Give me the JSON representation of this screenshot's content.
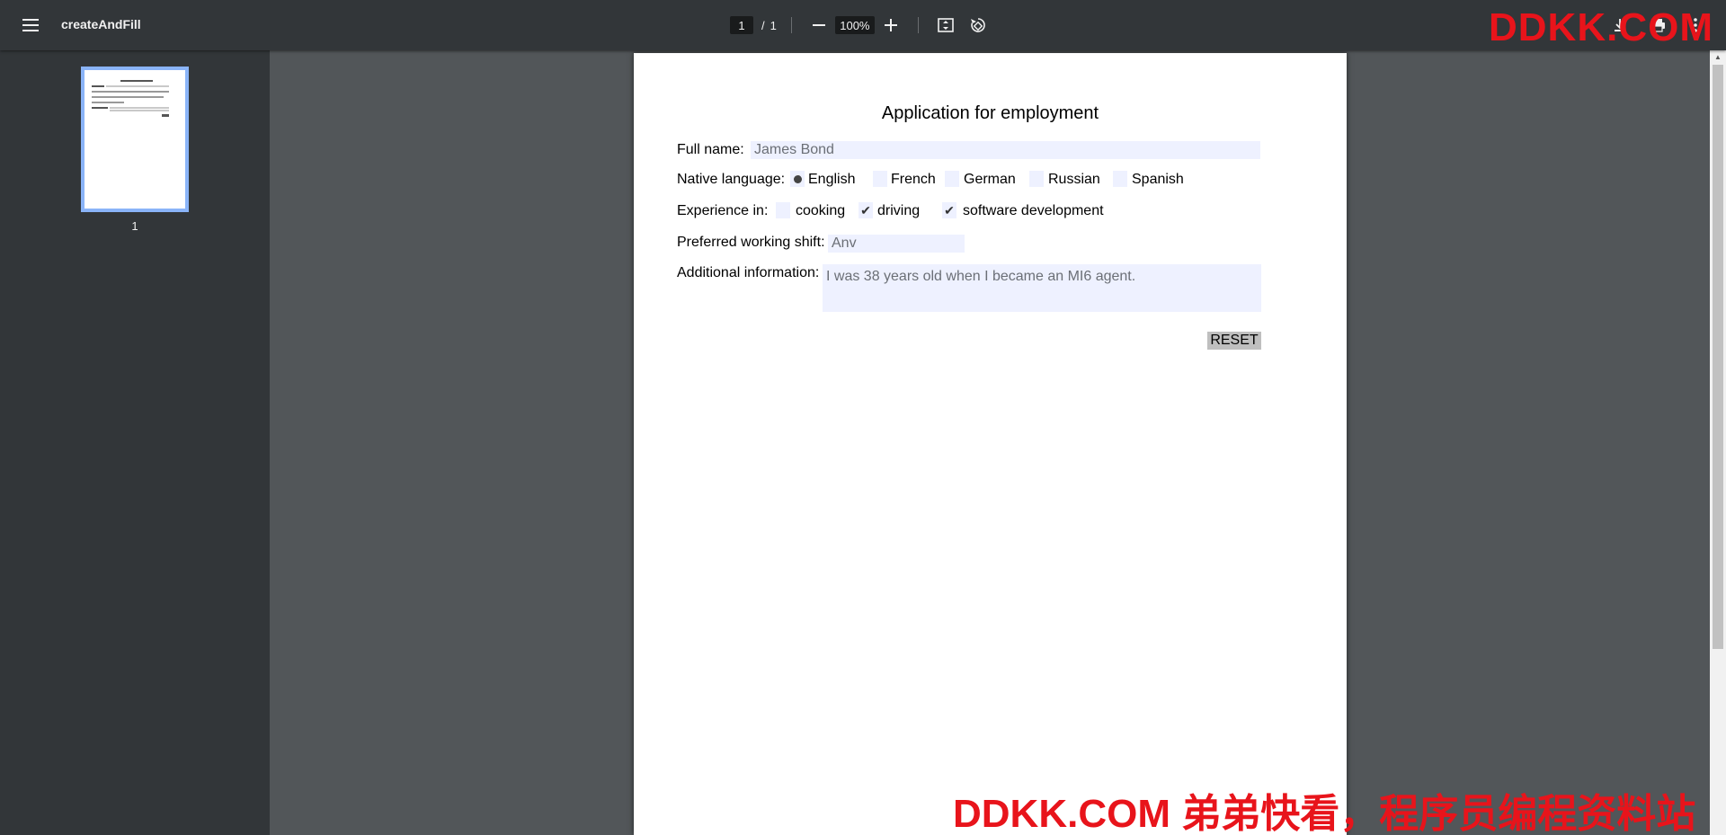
{
  "toolbar": {
    "title": "createAndFill",
    "page_current": "1",
    "page_separator": "/",
    "page_total": "1",
    "zoom": "100%"
  },
  "sidebar": {
    "thumbnail_label": "1"
  },
  "document": {
    "title": "Application for employment",
    "full_name_label": "Full name:",
    "full_name_value": "James Bond",
    "native_language_label": "Native language:",
    "languages": [
      "English",
      "French",
      "German",
      "Russian",
      "Spanish"
    ],
    "selected_language": "English",
    "experience_label": "Experience in:",
    "experience_options": [
      {
        "label": "cooking",
        "checked": false
      },
      {
        "label": "driving",
        "checked": true
      },
      {
        "label": "software development",
        "checked": true
      }
    ],
    "shift_label": "Preferred working shift:",
    "shift_value": "Anv",
    "additional_label": "Additional information:",
    "additional_value": "I was 38 years old when I became an MI6 agent.",
    "reset_label": "RESET"
  },
  "watermark": {
    "top": "DDKK.COM",
    "bottom": "DDKK.COM 弟弟快看，程序员编程资料站"
  },
  "icons": [
    "menu-icon",
    "zoom-out-icon",
    "zoom-in-icon",
    "fit-page-icon",
    "rotate-icon",
    "download-icon",
    "print-icon",
    "more-icon"
  ]
}
